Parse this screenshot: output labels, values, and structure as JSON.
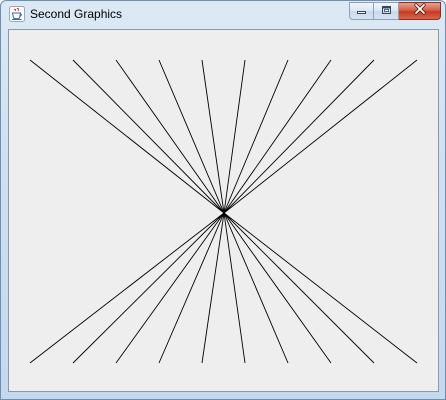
{
  "window": {
    "title": "Second Graphics",
    "icon": "java-cup-icon",
    "controls": {
      "minimize_icon": "minimize-icon",
      "maximize_icon": "maximize-icon",
      "close_icon": "close-icon"
    }
  },
  "colors": {
    "canvas_background": "#eeeeee",
    "line_color": "#000000",
    "title_text": "#000000",
    "close_button": "#c43b21"
  }
}
